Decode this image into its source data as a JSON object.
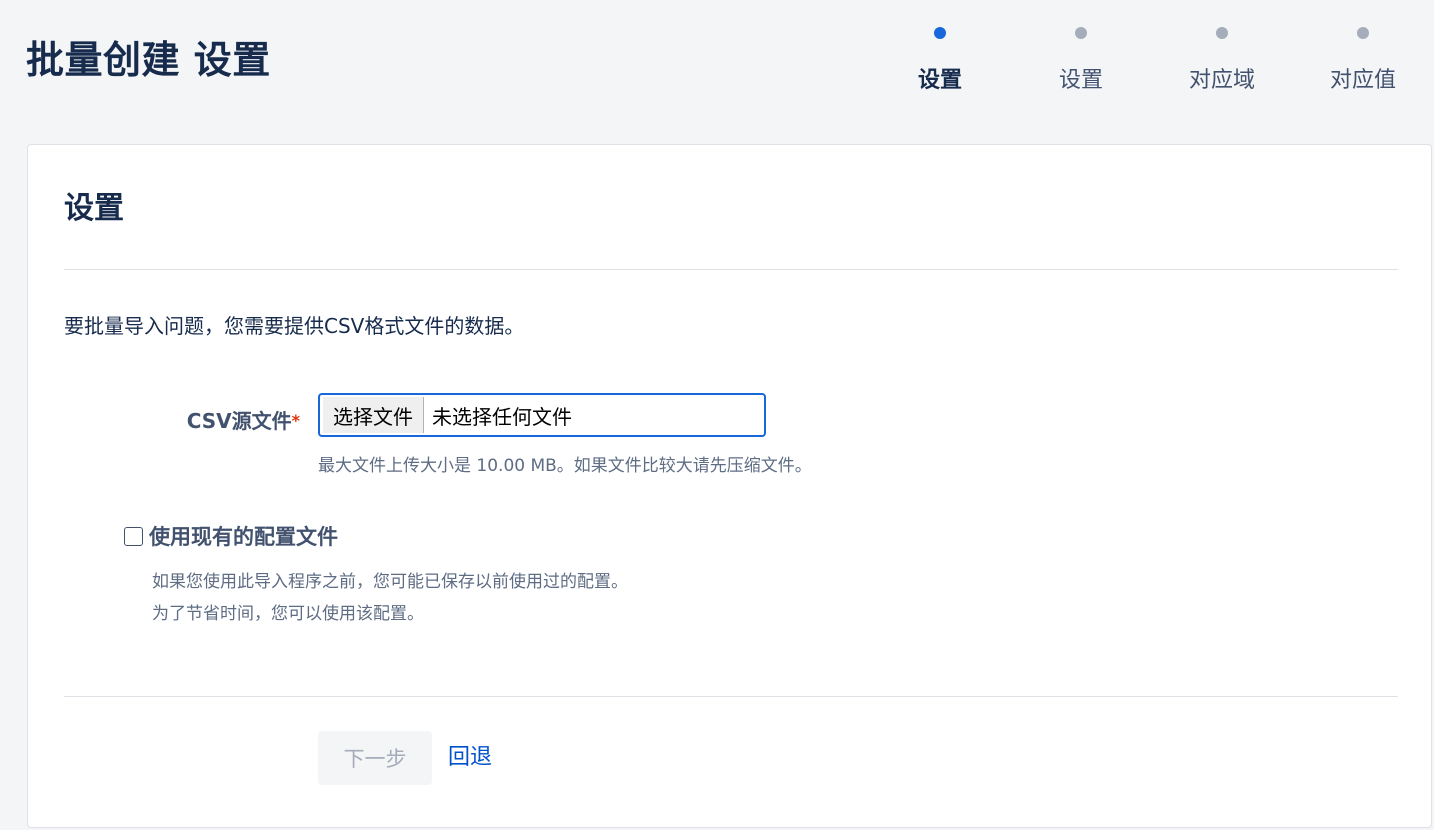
{
  "header": {
    "title": "批量创建 设置"
  },
  "progress": {
    "steps": [
      {
        "label": "设置",
        "state": "current"
      },
      {
        "label": "设置",
        "state": "todo"
      },
      {
        "label": "对应域",
        "state": "todo"
      },
      {
        "label": "对应值",
        "state": "todo"
      }
    ]
  },
  "card": {
    "title": "设置",
    "intro": "要批量导入问题，您需要提供CSV格式文件的数据。",
    "csv_field": {
      "label": "CSV源文件",
      "required_mark": "*",
      "choose_button": "选择文件",
      "status": "未选择任何文件",
      "help": "最大文件上传大小是 10.00 MB。如果文件比较大请先压缩文件。"
    },
    "existing_config": {
      "label": "使用现有的配置文件",
      "checked": false,
      "help_lines": [
        "如果您使用此导入程序之前，您可能已保存以前使用过的配置。",
        "为了节省时间，您可以使用该配置。"
      ]
    },
    "actions": {
      "next_label": "下一步",
      "back_label": "回退"
    }
  },
  "colors": {
    "accent": "#1868db",
    "link": "#0052cc",
    "required": "#de350b",
    "inactive_dot": "#a5adba",
    "page_background": "#f4f5f7"
  }
}
